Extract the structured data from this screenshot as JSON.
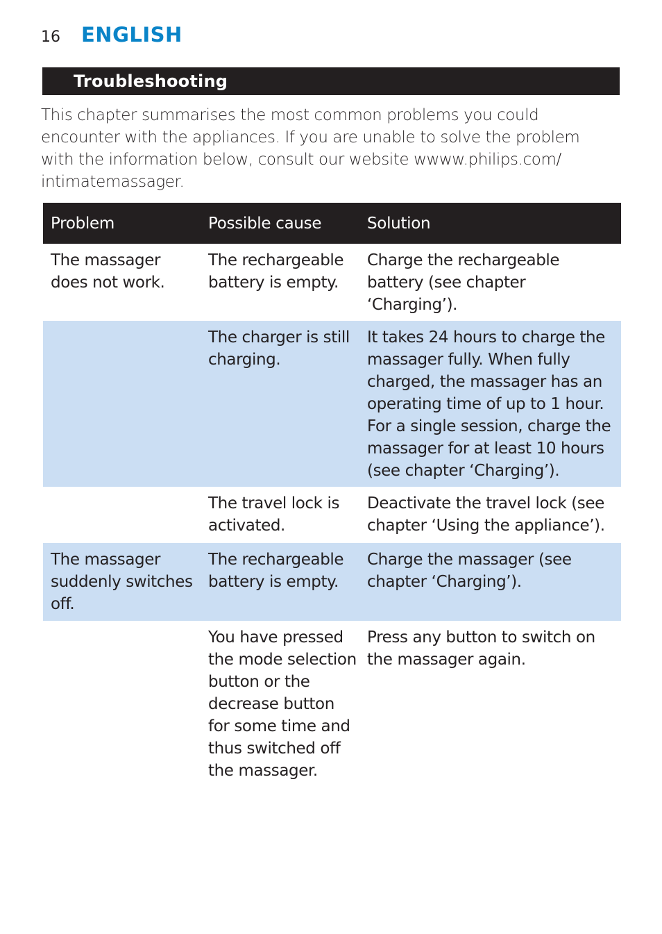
{
  "header": {
    "page_number": "16",
    "language": "ENGLISH",
    "language_color": "#0a84c8"
  },
  "section": {
    "title": "Troubleshooting"
  },
  "intro": "This chapter summarises the most common problems you could encounter with the appliances. If you are unable to solve the problem with the information below, consult our website wwww.philips.com/ intimatemassager.",
  "table": {
    "columns": [
      "Problem",
      "Possible cause",
      "Solution"
    ],
    "rows": [
      {
        "problem": "The massager does not work.",
        "cause": "The rechargeable battery is empty.",
        "solution": "Charge the rechargeable battery (see chapter ‘Charging’)."
      },
      {
        "problem": "",
        "cause": "The charger is still charging.",
        "solution": "It takes 24 hours to charge the massager fully. When fully charged, the massager has an operating time of up to 1 hour. For a single session, charge the massager for at least 10 hours (see chapter ‘Charging’)."
      },
      {
        "problem": "",
        "cause": "The travel lock is activated.",
        "solution": "Deactivate the travel lock (see chapter ‘Using the appliance’)."
      },
      {
        "problem": "The massager suddenly switches off.",
        "cause": "The rechargeable battery is empty.",
        "solution": "Charge the massager (see chapter ‘Charging’)."
      },
      {
        "problem": "",
        "cause": "You have pressed the mode selection button or the decrease button for some time and thus switched off the massager.",
        "solution": "Press any button to switch on the massager again."
      }
    ],
    "shaded_row_color": "#cbdef3",
    "header_color": "#231f20"
  }
}
